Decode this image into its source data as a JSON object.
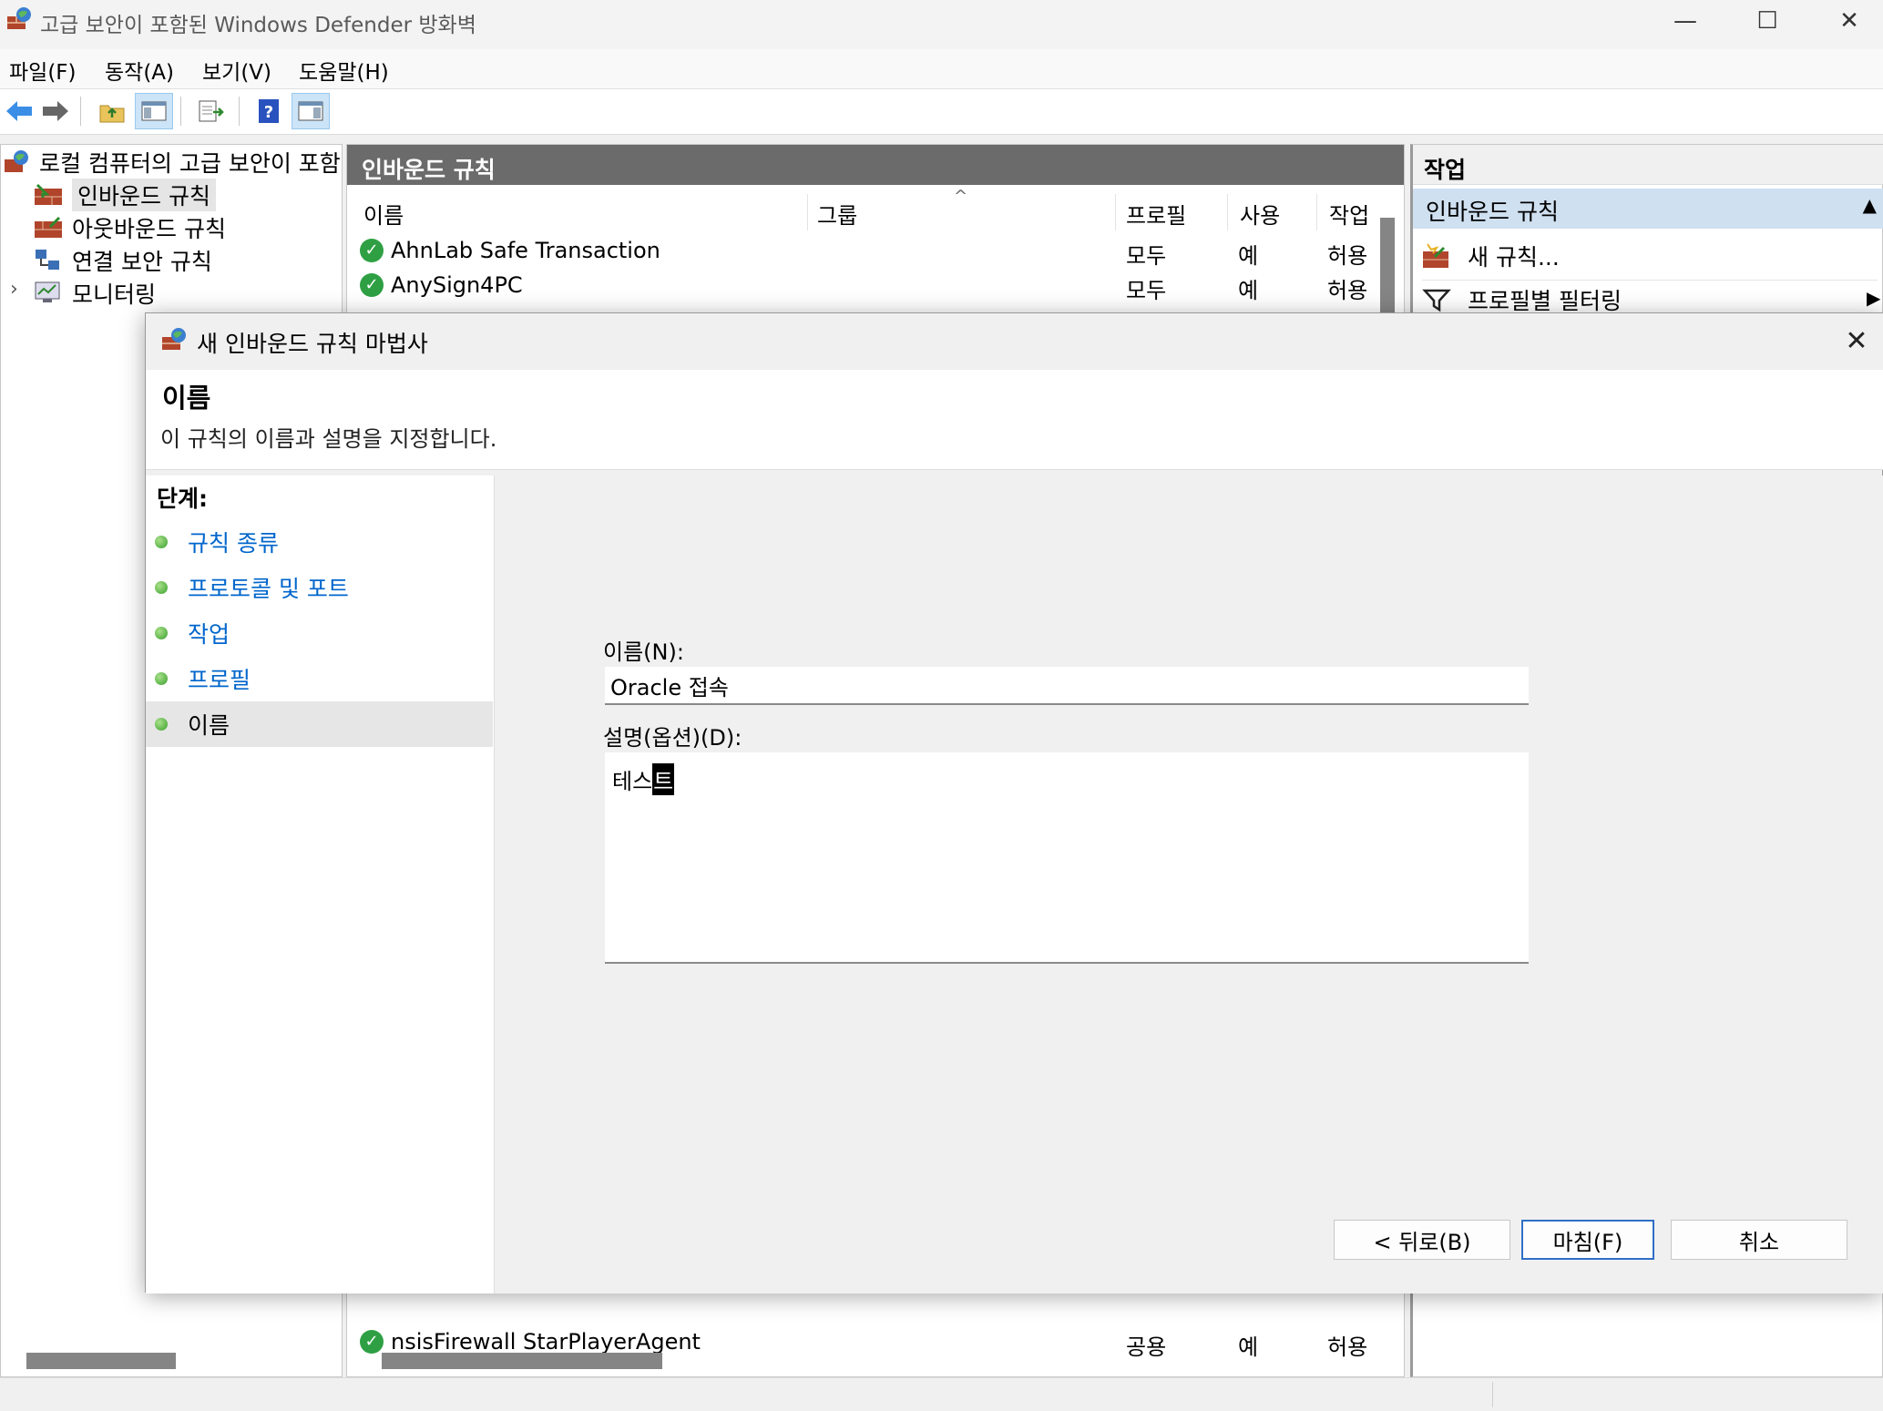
{
  "window": {
    "title": "고급 보안이 포함된 Windows Defender 방화벽",
    "min_glyph": "—",
    "max_glyph": "☐",
    "close_glyph": "✕"
  },
  "menu": [
    "파일(F)",
    "동작(A)",
    "보기(V)",
    "도움말(H)"
  ],
  "toolbar": {
    "icons": [
      "back-arrow-icon",
      "forward-arrow-icon",
      "up-folder-icon",
      "show-hide-tree-icon",
      "export-list-icon",
      "help-icon",
      "show-hide-action-pane-icon"
    ]
  },
  "tree": {
    "root": "로컬 컴퓨터의 고급 보안이 포함",
    "items": [
      "인바운드 규칙",
      "아웃바운드 규칙",
      "연결 보안 규칙",
      "모니터링"
    ],
    "expander": "›"
  },
  "center": {
    "header": "인바운드 규칙",
    "sort_glyph": "^",
    "columns": [
      "이름",
      "그룹",
      "프로필",
      "사용",
      "작업"
    ],
    "rows": [
      {
        "name": "AhnLab Safe Transaction",
        "group": "",
        "profile": "모두",
        "enabled": "예",
        "action": "허용"
      },
      {
        "name": "AnySign4PC",
        "group": "",
        "profile": "모두",
        "enabled": "예",
        "action": "허용"
      },
      {
        "name": "nsisFirewall StarPlayerAgent",
        "group": "",
        "profile": "공용",
        "enabled": "예",
        "action": "허용"
      }
    ]
  },
  "actions": {
    "header": "작업",
    "section": "인바운드 규칙",
    "collapse_glyph": "▲",
    "items": [
      "새 규칙...",
      "프로필별 필터링"
    ],
    "submenu_glyph": "▶"
  },
  "dialog": {
    "title": "새 인바운드 규칙 마법사",
    "close_glyph": "✕",
    "heading": "이름",
    "subheading": "이 규칙의 이름과 설명을 지정합니다.",
    "steps_title": "단계:",
    "steps": [
      "규칙 종류",
      "프로토콜 및 포트",
      "작업",
      "프로필",
      "이름"
    ],
    "name_label": "이름(N):",
    "name_value": "Oracle 접속",
    "desc_label": "설명(옵션)(D):",
    "desc_value": "테스",
    "desc_composing": "트",
    "buttons": {
      "back": "< 뒤로(B)",
      "finish": "마침(F)",
      "cancel": "취소"
    }
  },
  "colors": {
    "accent": "#0066cc",
    "header_bg": "#6b6b6b",
    "action_section_bg": "#cfe0f0",
    "check_green": "#2ea043",
    "primary_button_border": "#2f6fc7"
  }
}
